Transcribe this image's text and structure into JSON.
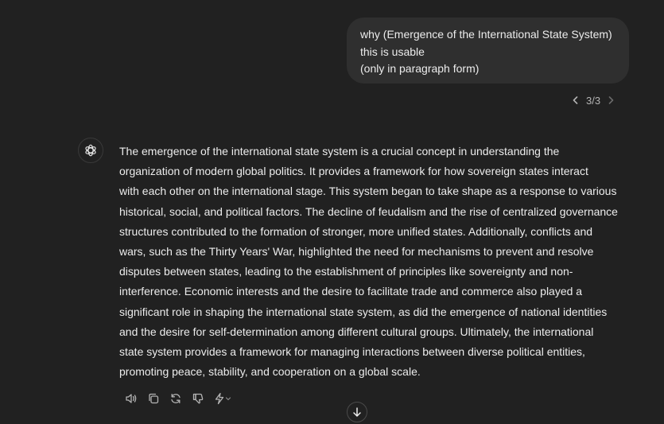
{
  "user_message": {
    "lines": [
      "why (Emergence of the International State System)",
      "this is usable",
      "(only in paragraph form)"
    ]
  },
  "pager": {
    "count": "3/3",
    "prev_icon": "chevron-left-icon",
    "next_icon": "chevron-right-icon"
  },
  "assistant": {
    "avatar_icon": "openai-logo-icon",
    "lines": [
      "The emergence of the international state system is a crucial concept in understanding the",
      "organization of modern global politics. It provides a framework for how sovereign states interact",
      "with each other on the international stage. This system began to take shape as a response to various",
      "historical, social, and political factors. The decline of feudalism and the rise of centralized governance",
      "structures contributed to the formation of stronger, more unified states. Additionally, conflicts and",
      "wars, such as the Thirty Years' War, highlighted the need for mechanisms to prevent and resolve",
      "disputes between states, leading to the establishment of principles like sovereignty and non-",
      "interference. Economic interests and the desire to facilitate trade and commerce also played a",
      "significant role in shaping the international state system, as did the emergence of national identities",
      "and the desire for self-determination among different cultural groups. Ultimately, the international",
      "state system provides a framework for managing interactions between diverse political entities,",
      "promoting peace, stability, and cooperation on a global scale."
    ]
  },
  "actions": [
    "read-aloud-icon",
    "copy-icon",
    "regenerate-icon",
    "thumbs-down-icon",
    "switch-model-icon"
  ],
  "colors": {
    "background": "#212121",
    "bubble": "#2f2f2f",
    "text": "#ececec",
    "muted": "#b4b4b4"
  }
}
